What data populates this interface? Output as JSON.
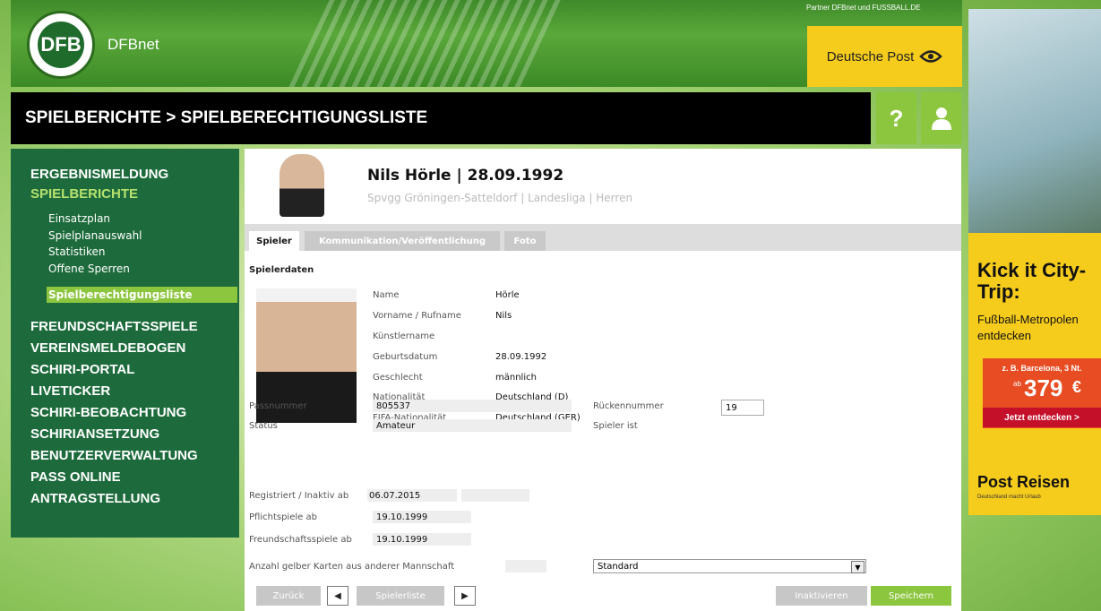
{
  "header": {
    "brand": "DFBnet",
    "partner": "Partner DFBnet und FUSSBALL.DE",
    "sponsor": "Deutsche Post",
    "logo_text": "DFB"
  },
  "titlebar": {
    "breadcrumb": "SPIELBERICHTE > SPIELBERECHTIGUNGSLISTE",
    "help_label": "?",
    "help_icon": "question-icon",
    "user_icon": "user-icon"
  },
  "sidebar": {
    "groups": [
      "ERGEBNISMELDUNG",
      "SPIELBERICHTE"
    ],
    "sub_items": [
      "Einsatzplan",
      "Spielplanauswahl",
      "Statistiken",
      "Offene Sperren",
      "Spielberechtigungsliste"
    ],
    "more": [
      "FREUNDSCHAFTSSPIELE",
      "VEREINSMELDEBOGEN",
      "SCHIRI-PORTAL",
      "LIVETICKER",
      "SCHIRI-BEOBACHTUNG",
      "SCHIRIANSETZUNG",
      "BENUTZERVERWALTUNG",
      "PASS ONLINE",
      "ANTRAGSTELLUNG"
    ],
    "active_color": "#8cc63f"
  },
  "player": {
    "headline": "Nils Hörle | 28.09.1992",
    "club_line": "Spvgg Gröningen-Satteldorf | Landesliga | Herren"
  },
  "tabs": [
    "Spieler",
    "Kommunikation/Veröffentlichung",
    "Foto"
  ],
  "section": {
    "title": "Spielerdaten"
  },
  "details": [
    {
      "label": "Name",
      "value": "Hörle"
    },
    {
      "label": "Vorname / Rufname",
      "value": "Nils"
    },
    {
      "label": "Künstlername",
      "value": ""
    },
    {
      "label": "Geburtsdatum",
      "value": "28.09.1992"
    },
    {
      "label": "Geschlecht",
      "value": "männlich"
    },
    {
      "label": "Nationalität",
      "value": "Deutschland (D)"
    },
    {
      "label": "FIFA-Nationalität",
      "value": "Deutschland (GER)"
    }
  ],
  "pass": {
    "passnummer_label": "Passnummer",
    "passnummer": "805537",
    "status_label": "Status",
    "status": "Amateur",
    "registriert_label": "Registriert / Inaktiv ab",
    "registriert": "06.07.2015",
    "pflicht_label": "Pflichtspiele ab",
    "pflicht": "19.10.1999",
    "freund_label": "Freundschaftsspiele ab",
    "freund": "19.10.1999",
    "rueck_label": "Rückennummer",
    "rueck": "19",
    "spieler_ist_label": "Spieler ist"
  },
  "yellow_cards": {
    "label": "Anzahl gelber Karten aus anderer Mannschaft",
    "select_value": "Standard"
  },
  "buttons": {
    "back": "Zurück",
    "prev_icon": "triangle-left-icon",
    "list": "Spielerliste",
    "next_icon": "triangle-right-icon",
    "deactivate": "Inaktivieren",
    "save": "Speichern",
    "save_color": "#8cc63f"
  },
  "ad": {
    "title": "Kick it City-Trip:",
    "subtitle": "Fußball-Metropolen entdecken",
    "example": "z. B. Barcelona, 3 Nt.",
    "price_prefix": "ab",
    "price": "379",
    "currency": "€",
    "cta": "Jetzt entdecken >",
    "brand": "Post Reisen",
    "slogan": "Deutschland macht Urlaub"
  }
}
